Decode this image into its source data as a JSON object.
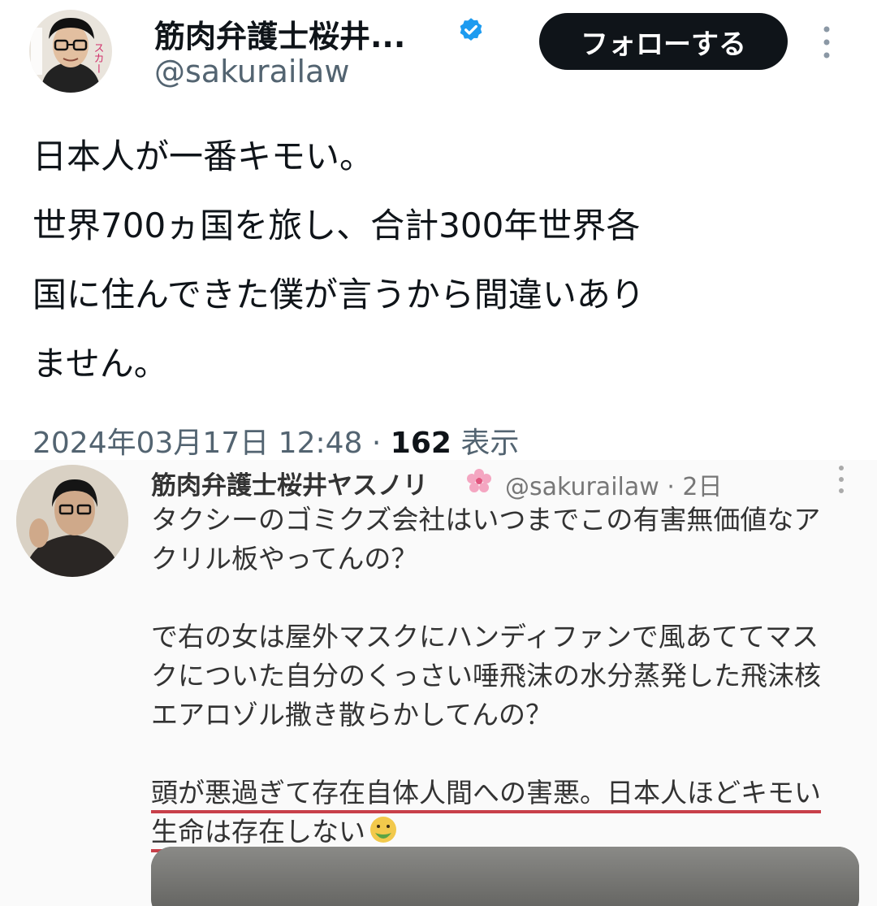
{
  "tweet": {
    "author_name": "筋肉弁護士桜井...",
    "handle": "@sakurailaw",
    "follow_label": "フォローする",
    "text_lines": [
      "日本人が一番キモい。",
      "世界700ヵ国を旅し、合計300年世界各",
      "国に住んできた僕が言うから間違いあり",
      "ません。"
    ],
    "timestamp": "2024年03月17日 12:48 · ",
    "views_count": "162",
    "views_label": " 表示",
    "avatar_sticker_text": "スカー"
  },
  "embedded": {
    "author_name": "筋肉弁護士桜井ヤスノリ",
    "handle": "@sakurailaw",
    "time": " · 2日",
    "lines": [
      "タクシーのゴミクズ会社はいつまでこの有害無価値なア",
      "クリル板やってんの？",
      "",
      "で右の女は屋外マスクにハンディファンで風あててマス",
      "クについた自分のくっさい唾飛沫の水分蒸発した飛沫核",
      "エアロゾル撒き散らかしてんの？",
      ""
    ],
    "underlined_line_1": "頭が悪過ぎて存在自体人間への害悪。日本人ほどキモい",
    "underlined_line_2": "生命は存在しない"
  },
  "colors": {
    "text": "#0f1419",
    "secondary": "#536471",
    "verified_blue": "#1d9bf0",
    "underline_red": "#c8404a",
    "button_bg": "#0f1419"
  },
  "icons": [
    "verified-badge-icon",
    "more-options-icon",
    "cherry-blossom-icon",
    "nauseated-face-icon"
  ]
}
